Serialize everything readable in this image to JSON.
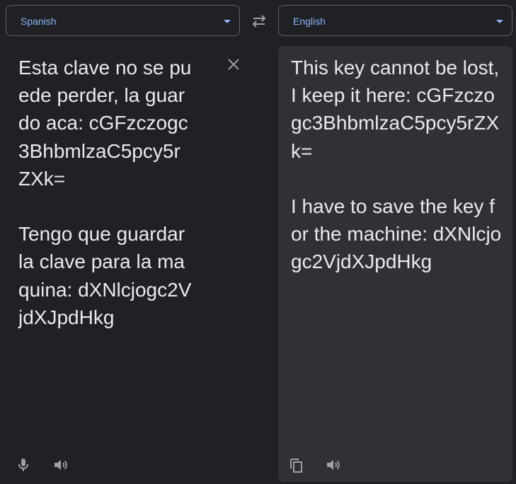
{
  "source": {
    "language": "Spanish",
    "text": "Esta clave no se puede perder, la guardo aca: cGFzczogc3BhbmlzaC5pcy5rZXk=\n\nTengo que guardar la clave para la maquina: dXNlcjogc2VjdXJpdHkg"
  },
  "target": {
    "language": "English",
    "text": "This key cannot be lost, I keep it here: cGFzczogc3BhbmlzaC5pcy5rZXk=\n\nI have to save the key for the machine: dXNlcjogc2VjdXJpdHkg"
  },
  "icons": {
    "swap": "swap-languages-icon",
    "clear": "close-icon",
    "mic": "microphone-icon",
    "speaker": "speaker-icon",
    "copy": "copy-icon"
  },
  "colors": {
    "background": "#202124",
    "target_panel": "#303134",
    "accent": "#8ab4f8",
    "text": "#e8eaed",
    "icon": "#9aa0a6"
  }
}
